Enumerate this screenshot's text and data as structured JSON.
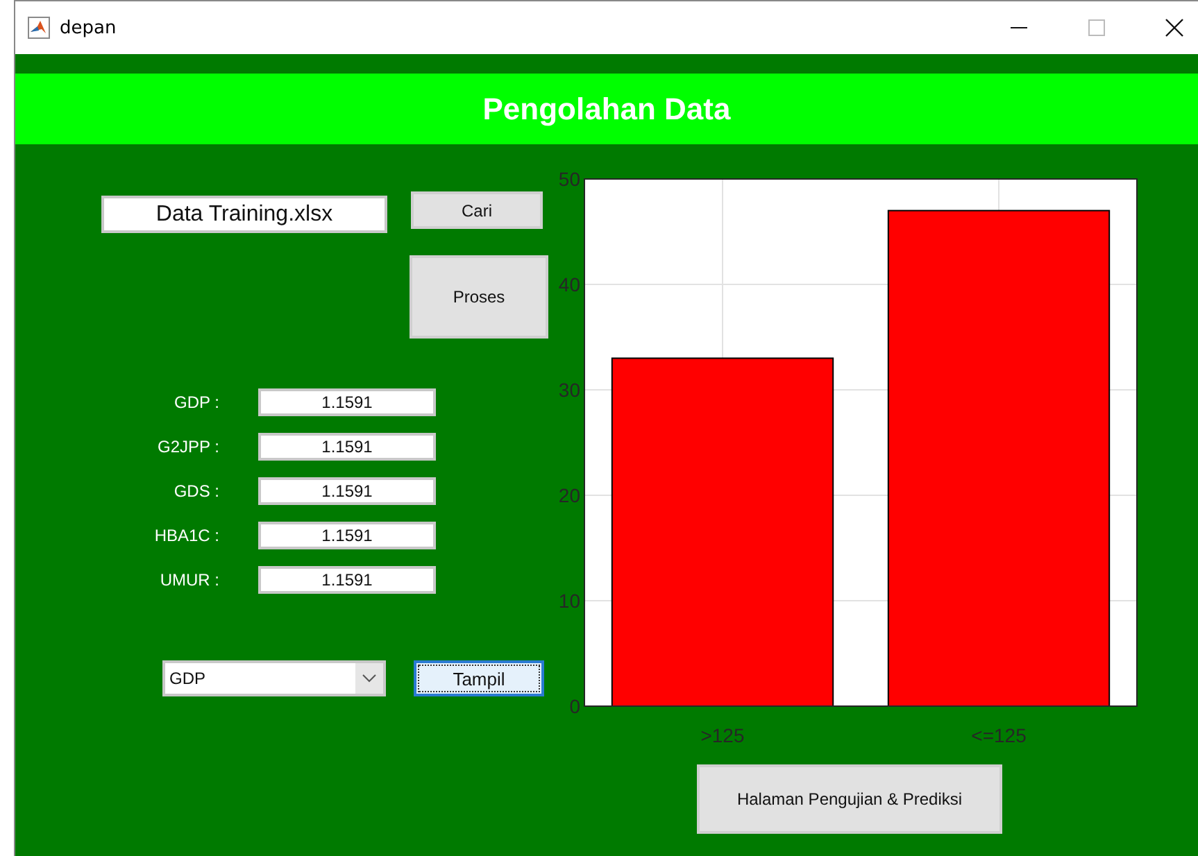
{
  "window": {
    "title": "depan"
  },
  "header": {
    "title": "Pengolahan Data"
  },
  "file_field": {
    "value": "Data Training.xlsx"
  },
  "buttons": {
    "browse": "Cari",
    "process": "Proses",
    "show": "Tampil",
    "next_page": "Halaman Pengujian & Prediksi"
  },
  "parameters": [
    {
      "label": "GDP :",
      "value": "1.1591"
    },
    {
      "label": "G2JPP :",
      "value": "1.1591"
    },
    {
      "label": "GDS :",
      "value": "1.1591"
    },
    {
      "label": "HBA1C :",
      "value": "1.1591"
    },
    {
      "label": "UMUR :",
      "value": "1.1591"
    }
  ],
  "dropdown": {
    "value": "GDP"
  },
  "chart": {
    "chart_data": {
      "type": "bar",
      "categories": [
        ">125",
        "<=125"
      ],
      "values": [
        33,
        47
      ],
      "grid": true,
      "ylim": [
        0,
        50
      ],
      "yticks": [
        0,
        10,
        20,
        30,
        40,
        50
      ]
    }
  }
}
